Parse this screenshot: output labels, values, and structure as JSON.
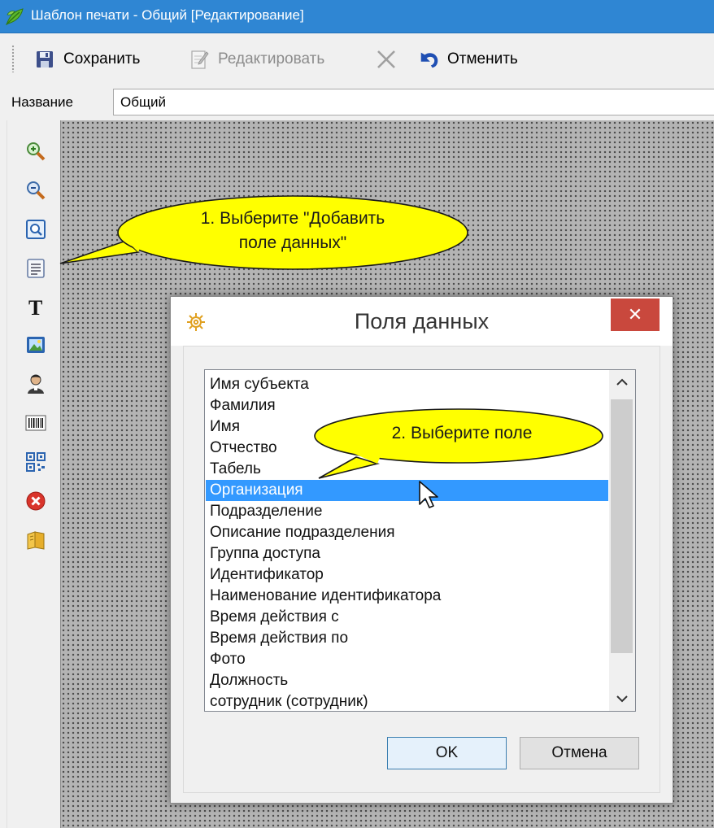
{
  "window": {
    "title": "Шаблон печати - Общий [Редактирование]",
    "app_icon": "green-leaf-icon",
    "accent": "#2f86d3"
  },
  "toolbar": {
    "save_label": "Сохранить",
    "edit_label": "Редактировать",
    "cancel_label": "Отменить",
    "icons": [
      "floppy-disk-icon",
      "edit-document-icon",
      "delete-x-icon",
      "undo-arrow-icon"
    ]
  },
  "name_field": {
    "label": "Название",
    "value": "Общий"
  },
  "palette": {
    "tools": [
      "zoom-in-icon",
      "zoom-out-icon",
      "zoom-fit-icon",
      "add-data-field-icon",
      "text-icon",
      "image-icon",
      "photo-person-icon",
      "barcode-icon",
      "qr-code-icon",
      "delete-icon",
      "book-icon"
    ]
  },
  "callouts": {
    "step1_line1": "1. Выберите \"Добавить",
    "step1_line2": "поле данных\"",
    "step2": "2. Выберите поле",
    "fill": "#ffff00"
  },
  "dialog": {
    "title": "Поля данных",
    "close_glyph": "✕",
    "close_color": "#c9483d",
    "ok_label": "OK",
    "cancel_label": "Отмена",
    "fields": [
      "Имя субъекта",
      "Фамилия",
      "Имя",
      "Отчество",
      "Табель",
      "Организация",
      "Подразделение",
      "Описание подразделения",
      "Группа доступа",
      "Идентификатор",
      "Наименование идентификатора",
      "Время действия с",
      "Время действия по",
      "Фото",
      "Должность",
      "сотрудник (сотрудник)"
    ],
    "selected_field": "Организация",
    "selection_color": "#3399ff"
  }
}
